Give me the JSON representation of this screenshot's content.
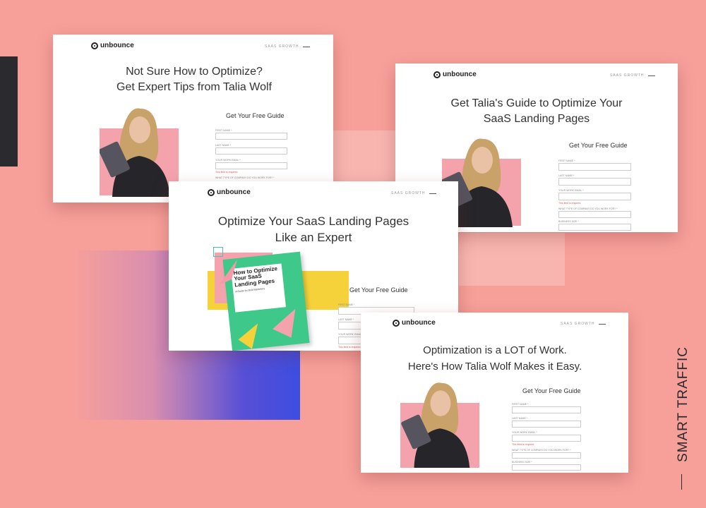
{
  "side_label": "SMART TRAFFIC",
  "colors": {
    "background": "#f7a09a",
    "accent_pink": "#f4a3ad",
    "book_green": "#3ec98a",
    "yellow": "#f6d23a"
  },
  "brand": "unbounce",
  "nav_label": "SAAS GROWTH",
  "form_title": "Get Your Free Guide",
  "labels": {
    "first_name": "FIRST NAME *",
    "last_name": "LAST NAME *",
    "email": "YOUR WORK EMAIL *",
    "required": "This field is required.",
    "company_type": "WHAT TYPE OF COMPANY DO YOU WORK FOR? *",
    "business_size": "BUSINESS SIZE *"
  },
  "cards": {
    "c1": {
      "title_line1": "Not Sure How to Optimize?",
      "title_line2": "Get Expert Tips from Talia Wolf"
    },
    "c2": {
      "title_line1": "Get Talia's Guide to Optimize Your",
      "title_line2": "SaaS Landing Pages"
    },
    "c3": {
      "title_line1": "Optimize Your SaaS Landing Pages",
      "title_line2": "Like an Expert",
      "book_title": "How to Optimize Your SaaS Landing Pages",
      "book_subtitle": "A Guide for Bold Marketers"
    },
    "c4": {
      "title_line1": "Optimization is a LOT of Work.",
      "title_line2": "Here's How Talia Wolf Makes it Easy."
    }
  }
}
